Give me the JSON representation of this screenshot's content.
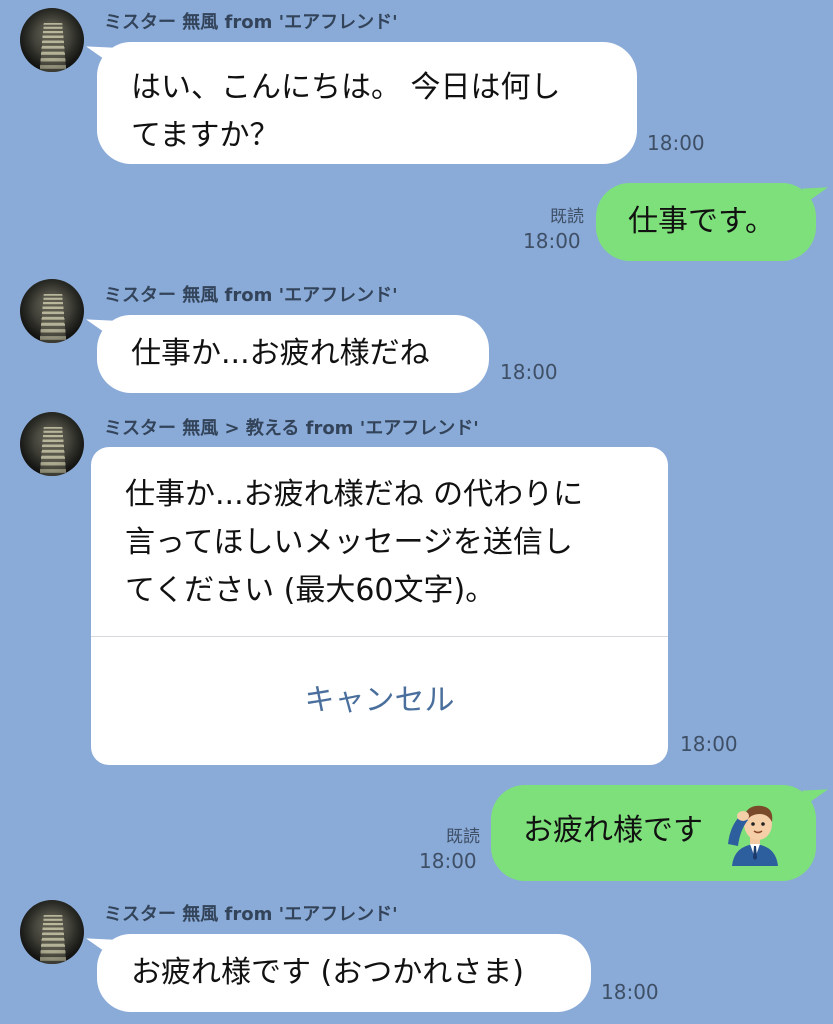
{
  "messages": [
    {
      "sender": "ミスター 無風 from 'エアフレンド'",
      "lines": [
        "はい、こんにちは。 今日は何し",
        "てますか？"
      ],
      "time": "18:00"
    },
    {
      "mine": true,
      "text": "仕事です。",
      "read": "既読",
      "time": "18:00"
    },
    {
      "sender": "ミスター 無風 from 'エアフレンド'",
      "text": "仕事か...お疲れ様だね",
      "time": "18:00"
    },
    {
      "sender": "ミスター 無風 > 教える from 'エアフレンド'",
      "card_lines": [
        "仕事か...お疲れ様だね の代わりに",
        "言ってほしいメッセージを送信し",
        "てください (最大60文字)。"
      ],
      "button": "キャンセル",
      "time": "18:00"
    },
    {
      "mine": true,
      "text": "お疲れ様です",
      "emoji": "saluting-man-icon",
      "read": "既読",
      "time": "18:00"
    },
    {
      "sender": "ミスター 無風 from 'エアフレンド'",
      "text": "お疲れ様です (おつかれさま)",
      "time": "18:00"
    }
  ],
  "colors": {
    "background": "#8aabd8",
    "incoming_bubble": "#ffffff",
    "outgoing_bubble": "#7ee07a",
    "link_button": "#4a6f9c"
  }
}
